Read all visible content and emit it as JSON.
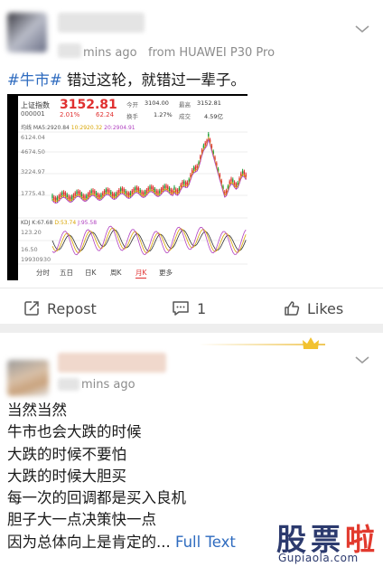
{
  "post1": {
    "time": "mins ago",
    "source": "from HUAWEI P30 Pro",
    "topic": "#牛市#",
    "text": " 错过这轮，就错过一辈子。",
    "chart": {
      "index_name": "上证指数",
      "index_code": "000001",
      "price": "3152.81",
      "change_pct": "2.01%",
      "change_pts": "62.24",
      "open_label": "今开",
      "open_value": "3104.00",
      "high_label": "最高",
      "high_value": "3152.81",
      "turnover_label": "换手",
      "turnover_value": "1.27%",
      "volume_label": "成交",
      "volume_value": "4.59亿",
      "ma_label": "均线 MA5:2920.84",
      "ma10": "10:2920.32",
      "ma20": "20:2904.91",
      "kdj_label": "KDJ",
      "kdj_k": "K:67.68",
      "kdj_d": "D:53.74",
      "kdj_j": "J:95.58",
      "y_ticks": [
        "6124.04",
        "4674.50",
        "3224.97",
        "1775.43"
      ],
      "sub_ticks": [
        "123.20",
        "16.50"
      ],
      "volume_tick": "19930930",
      "tabs": [
        "分时",
        "五日",
        "日K",
        "周K",
        "月K",
        "更多"
      ],
      "active_tab": "月K",
      "colors": {
        "up": "#e03030",
        "down": "#1f9e3a",
        "ma5": "#333333",
        "ma10": "#d8a400",
        "ma20": "#b040c0"
      }
    },
    "actions": {
      "repost": "Repost",
      "comments": "1",
      "likes": "Likes"
    }
  },
  "post2": {
    "time": "mins ago",
    "lines": [
      "当然当然",
      "牛市也会大跌的时候",
      "大跌的时候不要怕",
      "大跌的时候大胆买",
      "每一次的回调都是买入良机",
      "胆子大一点决策快一点",
      "因为总体向上是肯定的..."
    ],
    "full_text": "Full Text"
  },
  "watermark": {
    "chars": [
      "股",
      "票",
      "啦"
    ],
    "url": "Gupiaola.com"
  },
  "colors": {
    "link": "#2e6bbf",
    "meta": "#8c8c8c"
  }
}
